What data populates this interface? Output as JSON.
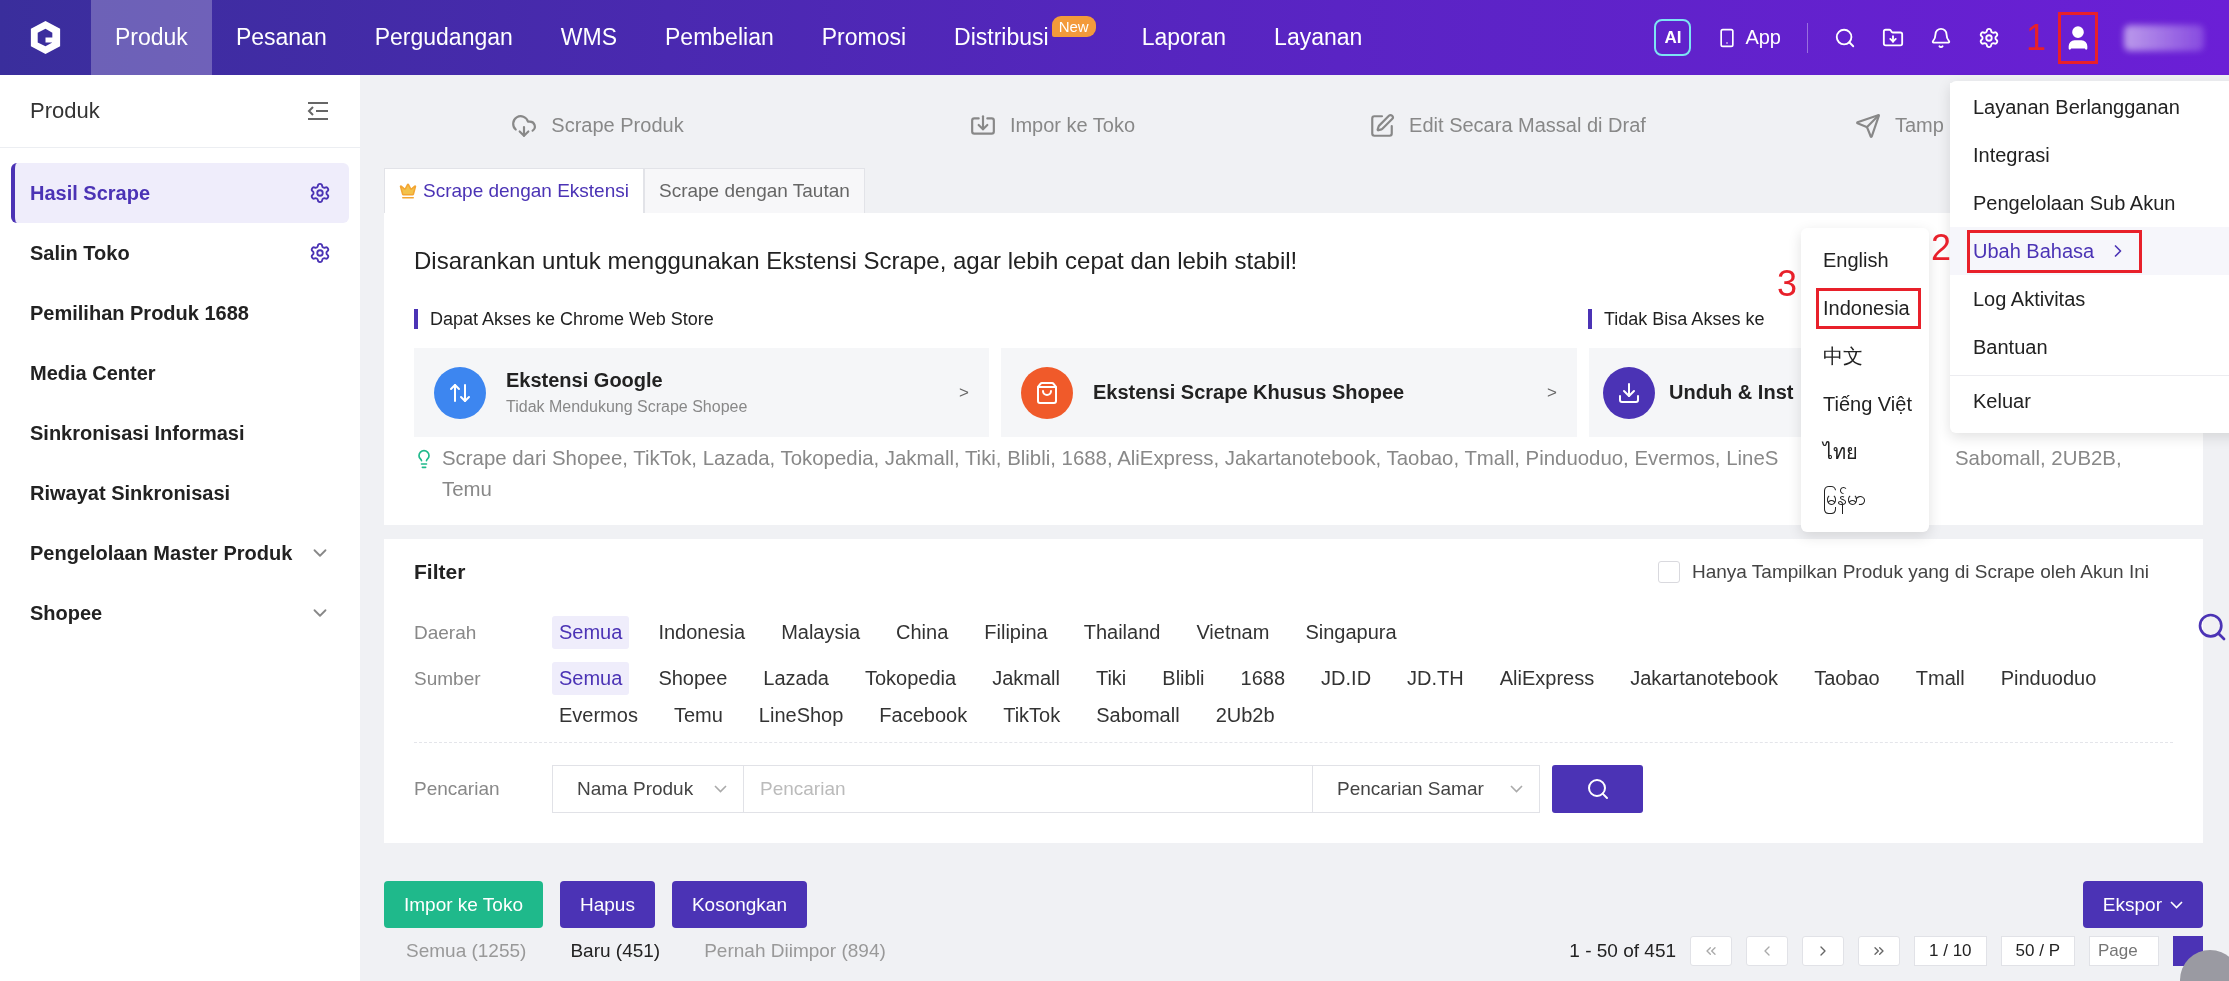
{
  "nav": {
    "items": [
      {
        "label": "Produk",
        "selected": true
      },
      {
        "label": "Pesanan",
        "selected": false
      },
      {
        "label": "Pergudangan",
        "selected": false
      },
      {
        "label": "WMS",
        "selected": false
      },
      {
        "label": "Pembelian",
        "selected": false
      },
      {
        "label": "Promosi",
        "selected": false
      },
      {
        "label": "Distribusi",
        "selected": false,
        "badge": "New"
      },
      {
        "label": "Laporan",
        "selected": false
      },
      {
        "label": "Layanan",
        "selected": false
      }
    ],
    "ai": "AI",
    "app": "App",
    "user_framed": true
  },
  "sidebar": {
    "title": "Produk",
    "items": [
      {
        "label": "Hasil Scrape",
        "selected": true,
        "kind": "settings"
      },
      {
        "label": "Salin Toko",
        "selected": false,
        "kind": "settings"
      },
      {
        "label": "Pemilihan Produk 1688",
        "selected": false,
        "kind": "plain"
      },
      {
        "label": "Media Center",
        "selected": false,
        "kind": "plain"
      },
      {
        "label": "Sinkronisasi Informasi",
        "selected": false,
        "kind": "plain"
      },
      {
        "label": "Riwayat Sinkronisasi",
        "selected": false,
        "kind": "plain"
      },
      {
        "label": "Pengelolaan Master Produk",
        "selected": false,
        "kind": "group"
      },
      {
        "label": "Shopee",
        "selected": false,
        "kind": "group"
      }
    ]
  },
  "toolbar": [
    {
      "label": "Scrape Produk",
      "kind": "scrape"
    },
    {
      "label": "Impor ke Toko",
      "kind": "import"
    },
    {
      "label": "Edit Secara Massal di Draf",
      "kind": "edit"
    },
    {
      "label": "Tamp",
      "kind": "send"
    }
  ],
  "tabs": [
    {
      "label": "Scrape dengan Ekstensi",
      "selected": true,
      "premium": true
    },
    {
      "label": "Scrape dengan Tautan",
      "selected": false,
      "premium": false
    }
  ],
  "extension_panel": {
    "headline": "Disarankan untuk menggunakan Ekstensi Scrape, agar lebih cepat dan lebih stabil!",
    "sections": [
      "Dapat Akses ke Chrome Web Store",
      "Tidak Bisa Akses ke"
    ],
    "cards": [
      {
        "kind": "google",
        "title": "Ekstensi Google",
        "subtitle": "Tidak Mendukung Scrape Shopee",
        "arrow": ">"
      },
      {
        "kind": "shopee",
        "title": "Ekstensi Scrape Khusus Shopee",
        "arrow": ">"
      },
      {
        "kind": "download",
        "title": "Unduh & Inst"
      }
    ],
    "hint": [
      "Scrape dari Shopee, TikTok, Lazada, Tokopedia, Jakmall, Tiki, Blibli, 1688, AliExpress, Jakartanotebook, Taobao, Tmall, Pinduoduo, Evermos, LineS",
      "Sabomall, 2UB2B,",
      "Temu"
    ]
  },
  "filter": {
    "title": "Filter",
    "only_mine": {
      "label": "Hanya Tampilkan Produk yang di Scrape oleh Akun Ini",
      "checked": false
    },
    "groups": [
      {
        "label": "Daerah",
        "options": [
          {
            "label": "Semua",
            "selected": true
          },
          {
            "label": "Indonesia",
            "selected": false
          },
          {
            "label": "Malaysia",
            "selected": false
          },
          {
            "label": "China",
            "selected": false
          },
          {
            "label": "Filipina",
            "selected": false
          },
          {
            "label": "Thailand",
            "selected": false
          },
          {
            "label": "Vietnam",
            "selected": false
          },
          {
            "label": "Singapura",
            "selected": false
          }
        ]
      },
      {
        "label": "Sumber",
        "options": [
          {
            "label": "Semua",
            "selected": true
          },
          {
            "label": "Shopee",
            "selected": false
          },
          {
            "label": "Lazada",
            "selected": false
          },
          {
            "label": "Tokopedia",
            "selected": false
          },
          {
            "label": "Jakmall",
            "selected": false
          },
          {
            "label": "Tiki",
            "selected": false
          },
          {
            "label": "Blibli",
            "selected": false
          },
          {
            "label": "1688",
            "selected": false
          },
          {
            "label": "JD.ID",
            "selected": false
          },
          {
            "label": "JD.TH",
            "selected": false
          },
          {
            "label": "AliExpress",
            "selected": false
          },
          {
            "label": "Jakartanotebook",
            "selected": false
          },
          {
            "label": "Taobao",
            "selected": false
          },
          {
            "label": "Tmall",
            "selected": false
          },
          {
            "label": "Pinduoduo",
            "selected": false
          },
          {
            "label": "Evermos",
            "selected": false
          },
          {
            "label": "Temu",
            "selected": false
          },
          {
            "label": "LineShop",
            "selected": false
          },
          {
            "label": "Facebook",
            "selected": false
          },
          {
            "label": "TikTok",
            "selected": false
          },
          {
            "label": "Sabomall",
            "selected": false
          },
          {
            "label": "2Ub2b",
            "selected": false
          }
        ]
      }
    ],
    "search": {
      "label": "Pencarian",
      "field": "Nama Produk",
      "placeholder": "Pencarian",
      "mode": "Pencarian Samar"
    }
  },
  "actions": [
    {
      "label": "Impor ke Toko",
      "kind": "success"
    },
    {
      "label": "Hapus",
      "kind": "primary"
    },
    {
      "label": "Kosongkan",
      "kind": "primary"
    }
  ],
  "export": {
    "label": "Ekspor"
  },
  "result_tabs": [
    {
      "label": "Semua (1255)",
      "selected": false
    },
    {
      "label": "Baru (451)",
      "selected": true
    },
    {
      "label": "Pernah Diimpor (894)",
      "selected": false
    }
  ],
  "pagination": {
    "range": "1 - 50 of 451",
    "page": "1 / 10",
    "size": "50 / P",
    "jump_placeholder": "Page"
  },
  "user_menu": {
    "items": [
      {
        "label": "Layanan Berlangganan",
        "kind": "link",
        "highlighted": false,
        "divider_before": false,
        "framed": false
      },
      {
        "label": "Integrasi",
        "kind": "link",
        "highlighted": false,
        "divider_before": false,
        "framed": false
      },
      {
        "label": "Pengelolaan Sub Akun",
        "kind": "link",
        "highlighted": false,
        "divider_before": false,
        "framed": false
      },
      {
        "label": "Ubah Bahasa",
        "kind": "submenu",
        "highlighted": true,
        "divider_before": false,
        "framed": true
      },
      {
        "label": "Log Aktivitas",
        "kind": "link",
        "highlighted": false,
        "divider_before": false,
        "framed": false
      },
      {
        "label": "Bantuan",
        "kind": "link",
        "highlighted": false,
        "divider_before": false,
        "framed": false
      },
      {
        "label": "Keluar",
        "kind": "link",
        "highlighted": false,
        "divider_before": true,
        "framed": false
      }
    ]
  },
  "language_menu": {
    "items": [
      {
        "label": "English",
        "framed": false
      },
      {
        "label": "Indonesia",
        "framed": true
      },
      {
        "label": "中文",
        "framed": false
      },
      {
        "label": "Tiếng Việt",
        "framed": false
      },
      {
        "label": "ไทย",
        "framed": false
      },
      {
        "label": "မြန်မာ",
        "framed": false
      }
    ]
  },
  "annotations": [
    {
      "label": "1"
    },
    {
      "label": "2"
    },
    {
      "label": "3"
    }
  ]
}
